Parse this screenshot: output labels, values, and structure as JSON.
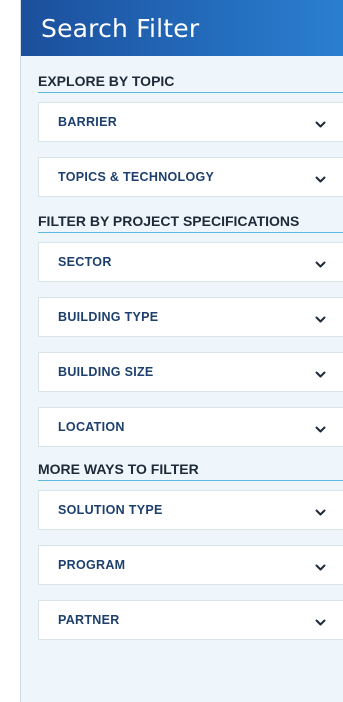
{
  "header": {
    "title": "Search Filter"
  },
  "sections": [
    {
      "heading": "EXPLORE BY TOPIC",
      "items": [
        {
          "label": "BARRIER"
        },
        {
          "label": "TOPICS & TECHNOLOGY"
        }
      ]
    },
    {
      "heading": "FILTER BY PROJECT SPECIFICATIONS",
      "items": [
        {
          "label": "SECTOR"
        },
        {
          "label": "BUILDING TYPE"
        },
        {
          "label": "BUILDING SIZE"
        },
        {
          "label": "LOCATION"
        }
      ]
    },
    {
      "heading": "MORE WAYS TO FILTER",
      "items": [
        {
          "label": "SOLUTION TYPE"
        },
        {
          "label": "PROGRAM"
        },
        {
          "label": "PARTNER"
        }
      ]
    }
  ],
  "icons": {
    "expand": "chevron-down-icon"
  },
  "colors": {
    "header_start": "#1b4f9c",
    "header_end": "#2a7fd1",
    "panel_bg": "#eef6fb",
    "heading_rule": "#5ab9e0",
    "item_label": "#1d3f6e"
  }
}
